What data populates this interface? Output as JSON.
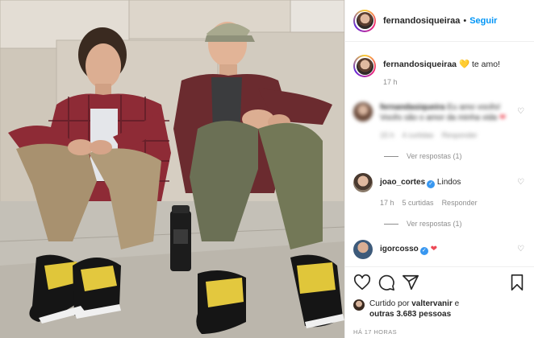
{
  "post": {
    "username": "fernandosiqueiraa",
    "separator": "•",
    "follow_label": "Seguir"
  },
  "caption": {
    "username": "fernandosiqueiraa",
    "emoji": "💛",
    "text": "te amo!",
    "time": "17 h"
  },
  "comments": [
    {
      "username": "fernandasiqueira",
      "text": "Eu amo vocês! Vocês são o amor da minha vida",
      "time": "15 h",
      "likes": "4 curtidas",
      "reply": "Responder",
      "view_replies": "Ver respostas (1)",
      "blurred": true
    },
    {
      "username": "joao_cortes",
      "text": "Lindos",
      "time": "17 h",
      "likes": "5 curtidas",
      "reply": "Responder",
      "view_replies": "Ver respostas (1)",
      "verified": true
    },
    {
      "username": "igorcosso",
      "text": "❤",
      "verified": true
    }
  ],
  "footer": {
    "liked_by_prefix": "Curtido por",
    "liked_by_user": "valtervanir",
    "liked_by_mid": "e",
    "liked_by_count": "outras 3.683 pessoas",
    "timestamp": "HÁ 17 HORAS"
  },
  "icons": {
    "like": "heart-icon",
    "comment": "comment-icon",
    "share": "share-icon",
    "save": "bookmark-icon"
  },
  "colors": {
    "accent": "#0095f6",
    "verified": "#3897f0",
    "secondary_text": "#8e8e8e",
    "heart": "#ed4956"
  }
}
